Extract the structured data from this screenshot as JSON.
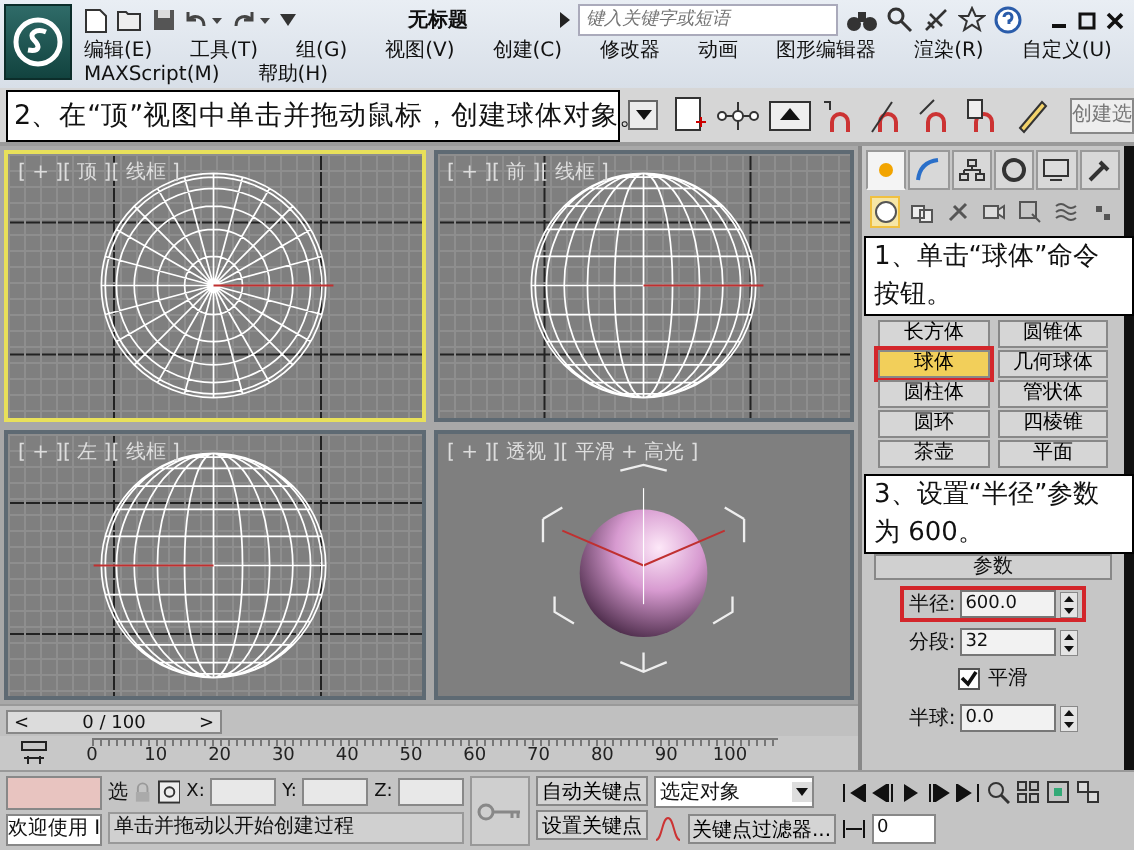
{
  "title_bar": {
    "title": "无标题",
    "search": {
      "placeholder": "键入关键字或短语"
    }
  },
  "menu": [
    "编辑(E)",
    "工具(T)",
    "组(G)",
    "视图(V)",
    "创建(C)",
    "修改器",
    "动画",
    "图形编辑器",
    "渲染(R)",
    "自定义(U)",
    "MAXScript(M)",
    "帮助(H)"
  ],
  "toolbar": {
    "callout": "2、在“顶”视图中单击并拖动鼠标，创建球体对象。",
    "selection_set": "创建选"
  },
  "viewports": [
    {
      "kind": "top",
      "label": "[ + ][ 顶 ][ 线框 ]",
      "selected": true
    },
    {
      "kind": "front",
      "label": "[ + ][ 前 ][ 线框 ]",
      "selected": false
    },
    {
      "kind": "left",
      "label": "[ + ][ 左 ][ 线框 ]",
      "selected": false
    },
    {
      "kind": "perspective",
      "label": "[ + ][ 透视 ][ 平滑 + 高光 ]",
      "selected": false
    }
  ],
  "command_panel": {
    "tabs": [
      {
        "selected": true
      },
      {
        "selected": false
      },
      {
        "selected": false
      },
      {
        "selected": false
      },
      {
        "selected": false
      },
      {
        "selected": false
      }
    ],
    "categories": [
      {
        "selected": true
      },
      {
        "selected": false
      },
      {
        "selected": false
      },
      {
        "selected": false
      },
      {
        "selected": false
      },
      {
        "selected": false
      },
      {
        "selected": false
      }
    ],
    "callout_1": "1、单击“球体”命令按钮。",
    "object_types": [
      {
        "label": "长方体",
        "selected": false
      },
      {
        "label": "圆锥体",
        "selected": false
      },
      {
        "label": "球体",
        "selected": true
      },
      {
        "label": "几何球体",
        "selected": false
      },
      {
        "label": "圆柱体",
        "selected": false
      },
      {
        "label": "管状体",
        "selected": false
      },
      {
        "label": "圆环",
        "selected": false
      },
      {
        "label": "四棱锥",
        "selected": false
      },
      {
        "label": "茶壶",
        "selected": false
      },
      {
        "label": "平面",
        "selected": false
      }
    ],
    "callout_3": "3、设置“半径”参数为 600。",
    "rollout": "参数",
    "params": [
      {
        "kind": "spinner",
        "label": "半径:",
        "value": "600.0",
        "highlighted": true
      },
      {
        "kind": "spinner",
        "label": "分段:",
        "value": "32",
        "highlighted": false
      },
      {
        "kind": "checkbox",
        "label": "平滑",
        "checked": true
      },
      {
        "kind": "spinner",
        "label": "半球:",
        "value": "0.0",
        "highlighted": false
      }
    ]
  },
  "timeline": {
    "prev": "<",
    "position": "0 / 100",
    "next": ">",
    "ticks": [
      "0",
      "10",
      "20",
      "30",
      "40",
      "50",
      "60",
      "70",
      "80",
      "90",
      "100"
    ]
  },
  "status_bar": {
    "welcome": "欢迎使用 I",
    "lock_label": "选",
    "coords": [
      {
        "label": "X:"
      },
      {
        "label": "Y:"
      },
      {
        "label": "Z:"
      }
    ],
    "prompt": "单击并拖动以开始创建过程",
    "auto_key": "自动关键点",
    "set_key": "设置关键点",
    "key_mode": "选定对象",
    "key_filters": "关键点过滤器...",
    "frame": "0"
  }
}
